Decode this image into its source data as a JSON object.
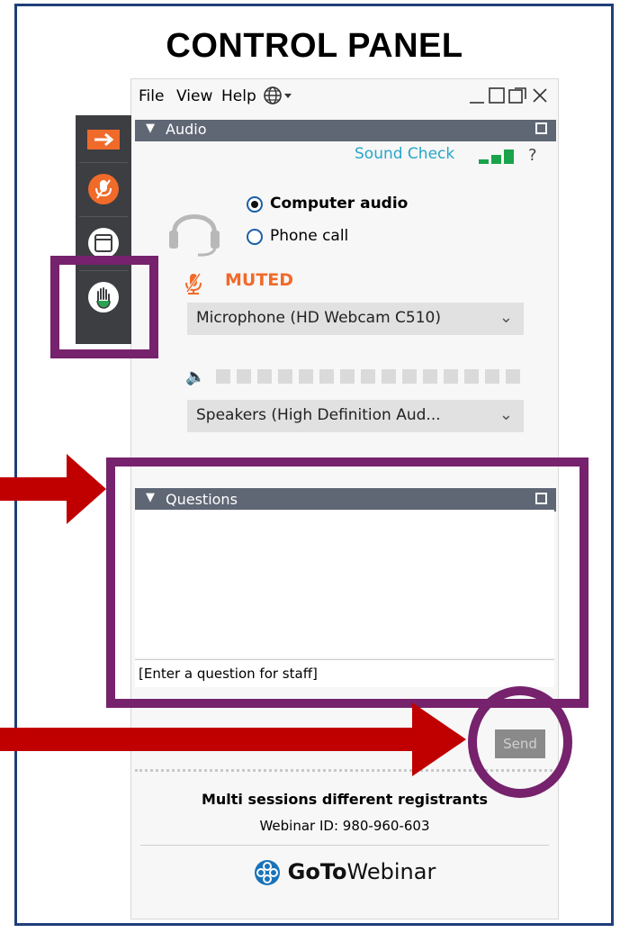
{
  "slide": {
    "title": "CONTROL PANEL"
  },
  "window": {
    "menu": [
      "File",
      "View",
      "Help"
    ],
    "controls": [
      "globe-icon",
      "minimize-icon",
      "maximize-icon",
      "popout-icon",
      "close-icon"
    ]
  },
  "sidebar": {
    "buttons": [
      "collapse-arrow-icon",
      "microphone-muted-icon",
      "screen-icon",
      "raise-hand-icon"
    ],
    "colors": {
      "bg": "#3d3e42",
      "accent": "#f06a2a"
    }
  },
  "audio": {
    "header": "Audio",
    "sound_check": "Sound Check",
    "help": "?",
    "options": [
      {
        "label": "Computer audio",
        "selected": true
      },
      {
        "label": "Phone call",
        "selected": false
      }
    ],
    "muted_label": "MUTED",
    "microphone": "Microphone (HD Webcam C510)",
    "speakers": "Speakers (High Definition Aud..."
  },
  "questions": {
    "header": "Questions",
    "placeholder": "[Enter a question for staff]",
    "send": "Send"
  },
  "footer": {
    "session": "Multi sessions different registrants",
    "webinar_id": "Webinar ID: 980-960-603",
    "brand_bold": "GoTo",
    "brand_rest": "Webinar"
  },
  "colors": {
    "highlight": "#76226d",
    "arrow": "#c00000",
    "frame": "#1f3f7a",
    "header_bar": "#5f6775",
    "sound_check": "#27a6c9",
    "muted": "#f06a2a"
  }
}
